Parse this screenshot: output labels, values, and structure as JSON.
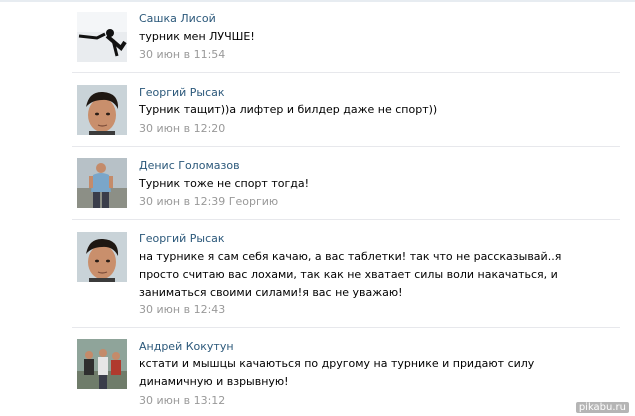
{
  "comments": [
    {
      "author": "Сашка Лисой",
      "text": "турник мен ЛУЧШЕ!",
      "meta": "30 июн в 11:54",
      "avatar": "avatar-silhouette-bar"
    },
    {
      "author": "Георгий Рысак",
      "text": "Турник тащит))а лифтер и билдер даже не спорт))",
      "meta": "30 июн в 12:20",
      "avatar": "avatar-face"
    },
    {
      "author": "Денис Голомазов",
      "text": "Турник тоже не спорт тогда!",
      "meta": "30 июн в 12:39 Георгию",
      "avatar": "avatar-standing-man"
    },
    {
      "author": "Георгий Рысак",
      "text": "на турнике я сам себя качаю, а вас таблетки! так что не рассказывай..я просто считаю вас лохами, так как не хватает силы воли накачаться, и заниматься своими силами!я вас не уважаю!",
      "meta": "30 июн в 12:43",
      "avatar": "avatar-face"
    },
    {
      "author": "Андрей Кокутун",
      "text": "кстати и мышцы качаються по другому на турнике и придают силу динамичную и взрывную!",
      "meta": "30 июн в 13:12",
      "avatar": "avatar-group"
    }
  ],
  "watermark": "pikabu.ru",
  "colors": {
    "author": "#2b587a",
    "meta": "#999999",
    "separator": "#e7e8ec"
  }
}
